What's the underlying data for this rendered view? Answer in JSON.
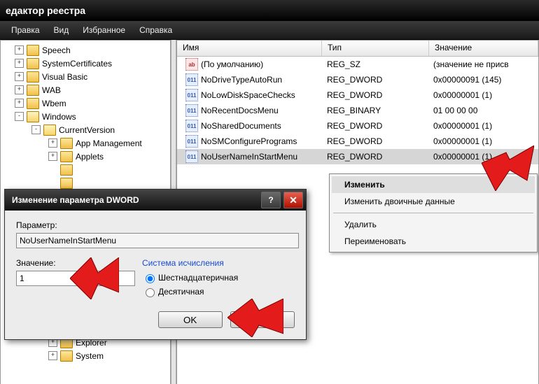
{
  "window": {
    "title": "едактор реестра"
  },
  "menu": [
    "Правка",
    "Вид",
    "Избранное",
    "Справка"
  ],
  "tree": [
    {
      "pad": 20,
      "exp": "+",
      "label": "Speech"
    },
    {
      "pad": 20,
      "exp": "+",
      "label": "SystemCertificates"
    },
    {
      "pad": 20,
      "exp": "+",
      "label": "Visual Basic"
    },
    {
      "pad": 20,
      "exp": "+",
      "label": "WAB"
    },
    {
      "pad": 20,
      "exp": "+",
      "label": "Wbem"
    },
    {
      "pad": 20,
      "exp": "-",
      "label": "Windows",
      "open": true
    },
    {
      "pad": 44,
      "exp": "-",
      "label": "CurrentVersion",
      "open": true
    },
    {
      "pad": 68,
      "exp": "+",
      "label": "App Management"
    },
    {
      "pad": 68,
      "exp": "+",
      "label": "Applets"
    },
    {
      "pad": 68,
      "exp": "",
      "label": ""
    },
    {
      "pad": 68,
      "exp": "",
      "label": ""
    },
    {
      "pad": 68,
      "exp": "",
      "label": ""
    },
    {
      "pad": 68,
      "exp": "",
      "label": ""
    },
    {
      "pad": 68,
      "exp": "",
      "label": ""
    },
    {
      "pad": 68,
      "exp": "",
      "label": ""
    },
    {
      "pad": 68,
      "exp": "",
      "label": ""
    },
    {
      "pad": 68,
      "exp": "",
      "label": ""
    },
    {
      "pad": 68,
      "exp": "",
      "label": ""
    },
    {
      "pad": 68,
      "exp": "",
      "label": ""
    },
    {
      "pad": 68,
      "exp": "",
      "label": ""
    },
    {
      "pad": 68,
      "exp": "",
      "label": ""
    },
    {
      "pad": 68,
      "exp": "",
      "label": ""
    },
    {
      "pad": 68,
      "exp": "+",
      "label": "Explorer"
    },
    {
      "pad": 68,
      "exp": "+",
      "label": "System"
    }
  ],
  "columns": {
    "name": "Имя",
    "type": "Тип",
    "value": "Значение"
  },
  "rows": [
    {
      "icon": "str",
      "name": "(По умолчанию)",
      "type": "REG_SZ",
      "value": "(значение не присв"
    },
    {
      "icon": "bin",
      "name": "NoDriveTypeAutoRun",
      "type": "REG_DWORD",
      "value": "0x00000091 (145)"
    },
    {
      "icon": "bin",
      "name": "NoLowDiskSpaceChecks",
      "type": "REG_DWORD",
      "value": "0x00000001 (1)"
    },
    {
      "icon": "bin",
      "name": "NoRecentDocsMenu",
      "type": "REG_BINARY",
      "value": "01 00 00 00"
    },
    {
      "icon": "bin",
      "name": "NoSharedDocuments",
      "type": "REG_DWORD",
      "value": "0x00000001 (1)"
    },
    {
      "icon": "bin",
      "name": "NoSMConfigurePrograms",
      "type": "REG_DWORD",
      "value": "0x00000001 (1)"
    },
    {
      "icon": "bin",
      "name": "NoUserNameInStartMenu",
      "type": "REG_DWORD",
      "value": "0x00000001 (1)",
      "sel": true
    }
  ],
  "ctx": {
    "modify": "Изменить",
    "modify_bin": "Изменить двоичные данные",
    "delete": "Удалить",
    "rename": "Переименовать"
  },
  "dlg": {
    "title": "Изменение параметра DWORD",
    "param_label": "Параметр:",
    "param_value": "NoUserNameInStartMenu",
    "value_label": "Значение:",
    "value": "1",
    "radix_title": "Система исчисления",
    "radix_hex": "Шестнадцатеричная",
    "radix_dec": "Десятичная",
    "ok": "OK",
    "cancel": "Отмена"
  }
}
